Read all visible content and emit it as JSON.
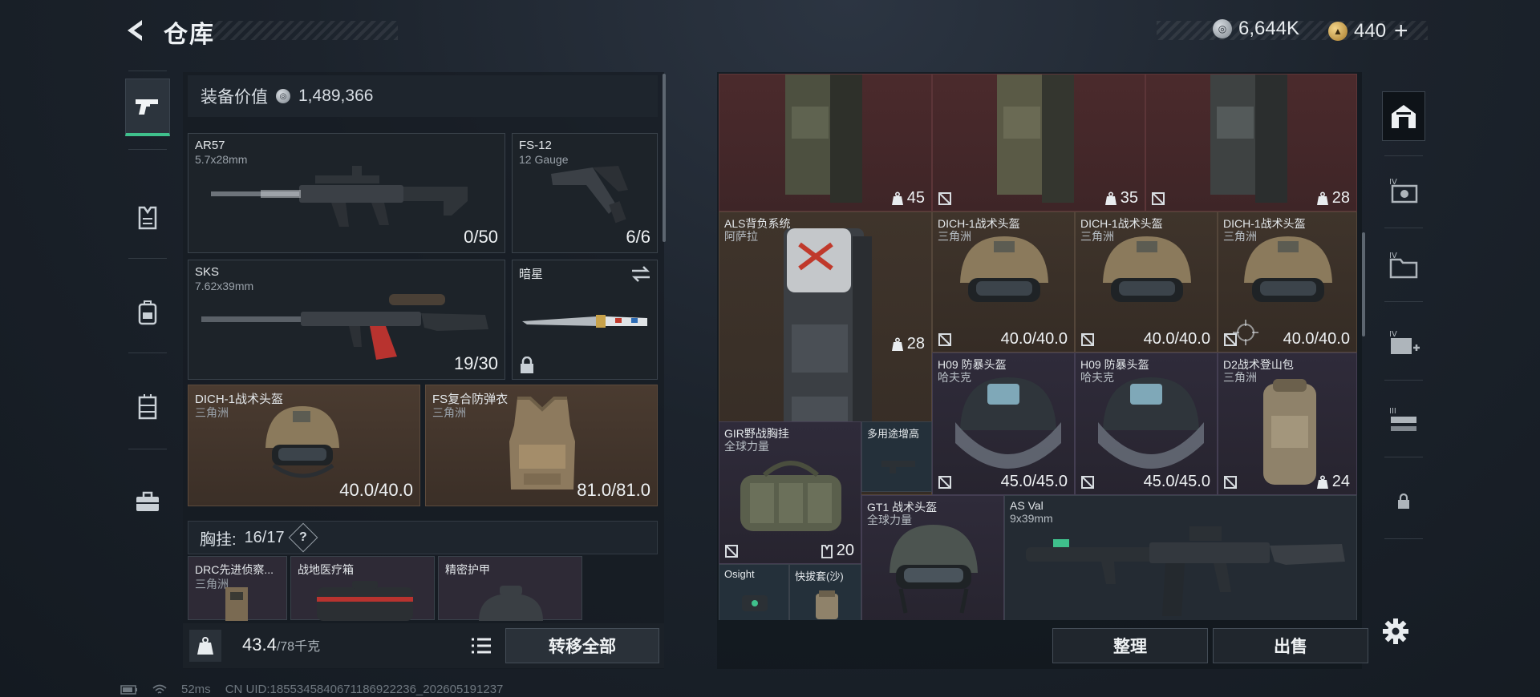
{
  "header": {
    "title": "仓库",
    "currency_silver": "6,644K",
    "currency_gold": "440",
    "plus": "+"
  },
  "left": {
    "equip_value_label": "装备价值",
    "equip_value": "1,489,366",
    "weapons": [
      {
        "name": "AR57",
        "ammo": "5.7x28mm",
        "count": "0/50"
      },
      {
        "name": "FS-12",
        "ammo": "12 Gauge",
        "count": "6/6"
      },
      {
        "name": "SKS",
        "ammo": "7.62x39mm",
        "count": "19/30"
      },
      {
        "name": "暗星",
        "ammo": ""
      }
    ],
    "armor": [
      {
        "name": "DICH-1战术头盔",
        "origin": "三角洲",
        "durability": "40.0/40.0"
      },
      {
        "name": "FS复合防弹衣",
        "origin": "三角洲",
        "durability": "81.0/81.0"
      }
    ],
    "rig_label": "胸挂:",
    "rig_count": "16/17",
    "rig_help": "?",
    "rig_items": [
      {
        "name": "DRC先进侦察...",
        "origin": "三角洲"
      },
      {
        "name": "战地医疗箱"
      },
      {
        "name": "精密护甲"
      }
    ],
    "weight": "43.4",
    "weight_max": "/78千克",
    "transfer_all": "转移全部"
  },
  "grid": {
    "row0": [
      {
        "count": "45"
      },
      {
        "count": "35"
      },
      {
        "count": "28"
      }
    ],
    "backpack": {
      "name": "ALS背负系统",
      "origin": "阿萨拉",
      "count": "28"
    },
    "helmets": [
      {
        "name": "DICH-1战术头盔",
        "origin": "三角洲",
        "durability": "40.0/40.0"
      },
      {
        "name": "DICH-1战术头盔",
        "origin": "三角洲",
        "durability": "40.0/40.0"
      },
      {
        "name": "DICH-1战术头盔",
        "origin": "三角洲",
        "durability": "40.0/40.0"
      }
    ],
    "riot": [
      {
        "name": "H09 防暴头盔",
        "origin": "哈夫克",
        "durability": "45.0/45.0"
      },
      {
        "name": "H09 防暴头盔",
        "origin": "哈夫克",
        "durability": "45.0/45.0"
      }
    ],
    "d2": {
      "name": "D2战术登山包",
      "origin": "三角洲",
      "count": "24"
    },
    "gir": {
      "name": "GIR野战胸挂",
      "origin": "全球力量",
      "count": "20"
    },
    "multi": {
      "name": "多用途增高"
    },
    "gt1": {
      "name": "GT1 战术头盔",
      "origin": "全球力量"
    },
    "asval": {
      "name": "AS Val",
      "ammo": "9x39mm"
    },
    "osight": {
      "name": "Osight"
    },
    "holster": {
      "name": "快拔套(沙)"
    }
  },
  "actions": {
    "sort": "整理",
    "sell": "出售"
  },
  "status": {
    "ping": "52ms",
    "uid": "CN UID:1855345840671186922236_202605191237"
  },
  "colors": {
    "accent": "#3fc08c",
    "red_cell": "#4b2a2c",
    "brown_cell": "#3f342b",
    "purple_cell": "#2f2b3a"
  }
}
